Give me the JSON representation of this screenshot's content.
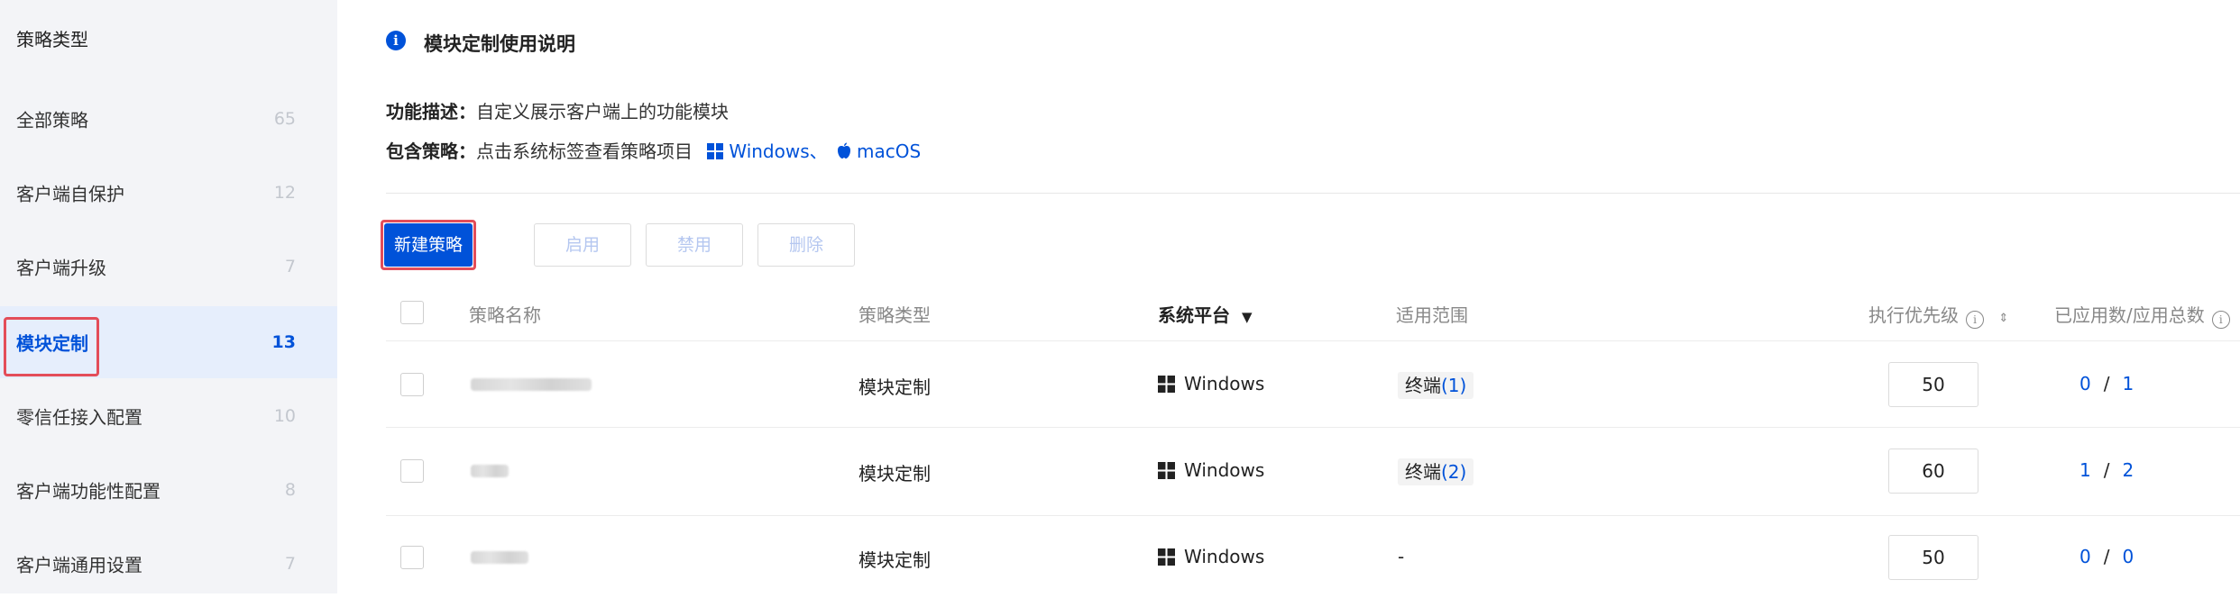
{
  "sidebar": {
    "title": "策略类型",
    "items": [
      {
        "label": "全部策略",
        "count": "65"
      },
      {
        "label": "客户端自保护",
        "count": "12"
      },
      {
        "label": "客户端升级",
        "count": "7"
      },
      {
        "label": "模块定制",
        "count": "13",
        "active": true
      },
      {
        "label": "零信任接入配置",
        "count": "10"
      },
      {
        "label": "客户端功能性配置",
        "count": "8"
      },
      {
        "label": "客户端通用设置",
        "count": "7"
      }
    ]
  },
  "guide": {
    "title": "模块定制使用说明",
    "desc_key": "功能描述：",
    "desc_value": "自定义展示客户端上的功能模块",
    "include_key": "包含策略：",
    "include_value": "点击系统标签查看策略项目",
    "platform_windows": "Windows、",
    "platform_macos": "macOS"
  },
  "toolbar": {
    "new_label": "新建策略",
    "enable_label": "启用",
    "disable_label": "禁用",
    "delete_label": "删除"
  },
  "table": {
    "headers": {
      "name": "策略名称",
      "type": "策略类型",
      "platform": "系统平台",
      "scope": "适用范围",
      "priority": "执行优先级",
      "usage": "已应用数/应用总数"
    },
    "rows": [
      {
        "type": "模块定制",
        "platform": "Windows",
        "scope_label": "终端",
        "scope_count": "(1)",
        "priority": "50",
        "applied": "0",
        "sep": "/",
        "total": "1"
      },
      {
        "type": "模块定制",
        "platform": "Windows",
        "scope_label": "终端",
        "scope_count": "(2)",
        "priority": "60",
        "applied": "1",
        "sep": "/",
        "total": "2"
      },
      {
        "type": "模块定制",
        "platform": "Windows",
        "scope_label": "",
        "scope_count": "",
        "scope_empty": "-",
        "priority": "50",
        "applied": "0",
        "sep": "/",
        "total": "0"
      }
    ]
  },
  "colors": {
    "accent": "#0052d9",
    "highlight": "#e34d59"
  }
}
